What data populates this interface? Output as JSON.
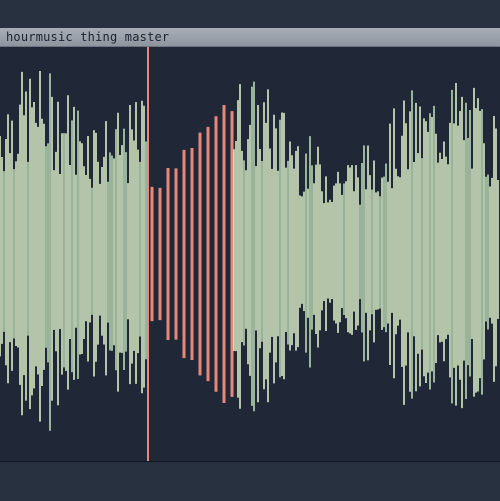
{
  "playlist": {
    "clip": {
      "title": "hourmusic thing master",
      "colors": {
        "header": "#9aa0a9",
        "wave_primary": "#d9ecc6",
        "wave_secondary": "#b9d8b5",
        "wave_selected": "#e88879",
        "background": "#202838"
      }
    }
  }
}
